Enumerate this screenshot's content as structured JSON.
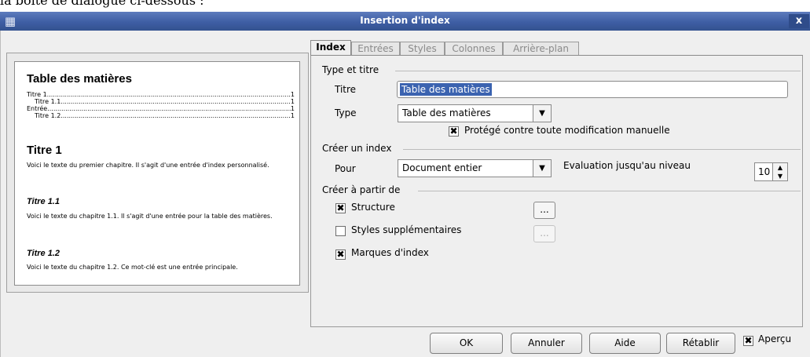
{
  "caption": "la boîte de dialogue ci-dessous :",
  "window": {
    "title": "Insertion d'index",
    "close_glyph": "x"
  },
  "preview": {
    "heading": "Table des matières",
    "toc": [
      {
        "label": "Titre 1",
        "page": "1",
        "indent": 0
      },
      {
        "label": "Titre 1.1",
        "page": "1",
        "indent": 1
      },
      {
        "label": "Entrée",
        "page": "1",
        "indent": 0
      },
      {
        "label": "Titre 1.2",
        "page": "1",
        "indent": 1
      }
    ],
    "h1": "Titre 1",
    "p1": "Voici le texte du premier chapitre. Il s'agit d'une entrée d'index personnalisé.",
    "h11": "Titre 1.1",
    "p11": "Voici le texte du chapitre 1.1. Il s'agit d'une entrée pour la table des matières.",
    "h12": "Titre 1.2",
    "p12": "Voici le texte du chapitre 1.2. Ce mot-clé est une entrée principale."
  },
  "tabs": [
    "Index",
    "Entrées",
    "Styles",
    "Colonnes",
    "Arrière-plan"
  ],
  "type_title": {
    "section": "Type et titre",
    "title_label": "Titre",
    "title_value": "Table des matières",
    "type_label": "Type",
    "type_value": "Table des matières",
    "protect_label": "Protégé contre toute modification manuelle",
    "protect_checked": true
  },
  "create_index": {
    "section": "Créer un index",
    "for_label": "Pour",
    "for_value": "Document entier",
    "level_label": "Evaluation jusqu'au niveau",
    "level_value": "10"
  },
  "create_from": {
    "section": "Créer à partir de",
    "structure_label": "Structure",
    "structure_checked": true,
    "styles_label": "Styles supplémentaires",
    "styles_checked": false,
    "marks_label": "Marques d'index",
    "marks_checked": true,
    "ellipsis": "..."
  },
  "buttons": {
    "ok": "OK",
    "cancel": "Annuler",
    "help": "Aide",
    "reset": "Rétablir",
    "preview": "Aperçu",
    "preview_checked": true
  }
}
